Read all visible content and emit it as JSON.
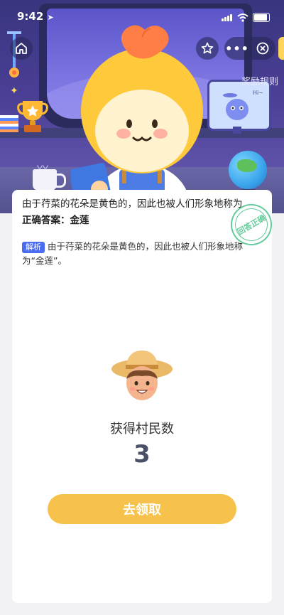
{
  "status_bar": {
    "time": "9:42"
  },
  "header": {
    "rules_link": "奖励规则",
    "monitor_text": "Hi~"
  },
  "card": {
    "question": "由于荇菜的花朵是黄色的，因此也被人们形象地称为",
    "correct_answer_label": "正确答案：",
    "correct_answer": "金莲",
    "stamp_text": "回答正确",
    "analysis_tag": "解析",
    "analysis_text": "由于荇菜的花朵是黄色的，因此也被人们形象地称为“金莲”。",
    "reward_label": "获得村民数",
    "reward_count": "3",
    "claim_button": "去领取"
  },
  "colors": {
    "accent": "#f7c24b",
    "tag_blue": "#4b6bf0",
    "stamp_green": "#49c28a",
    "header_purple": "#4a3f95"
  },
  "icons": [
    "home-icon",
    "star-icon",
    "more-icon",
    "close-icon",
    "location-arrow-icon",
    "signal-icon",
    "wifi-icon",
    "battery-icon"
  ]
}
